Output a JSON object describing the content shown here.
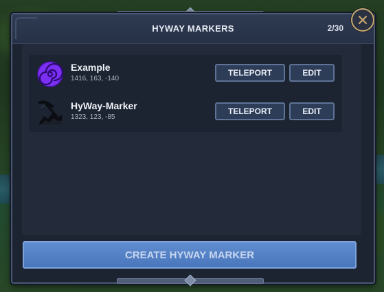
{
  "dialog": {
    "title": "HYWAY MARKERS",
    "count": "2/30",
    "close_icon": "close-icon"
  },
  "markers": [
    {
      "name": "Example",
      "coords": "1416, 163, -140",
      "icon": "purple-spiral-portal-icon",
      "teleport_label": "TELEPORT",
      "edit_label": "EDIT"
    },
    {
      "name": "HyWay-Marker",
      "coords": "1323, 123, -85",
      "icon": "pickaxe-rock-icon",
      "teleport_label": "TELEPORT",
      "edit_label": "EDIT"
    }
  ],
  "create_button": {
    "label": "CREATE HYWAY MARKER"
  },
  "colors": {
    "panel_bg": "#1c2331",
    "button_border": "#5e7397",
    "create_button": "#4a76bb",
    "close_ring": "#c7a870",
    "portal_purple": "#7b2ff2"
  }
}
